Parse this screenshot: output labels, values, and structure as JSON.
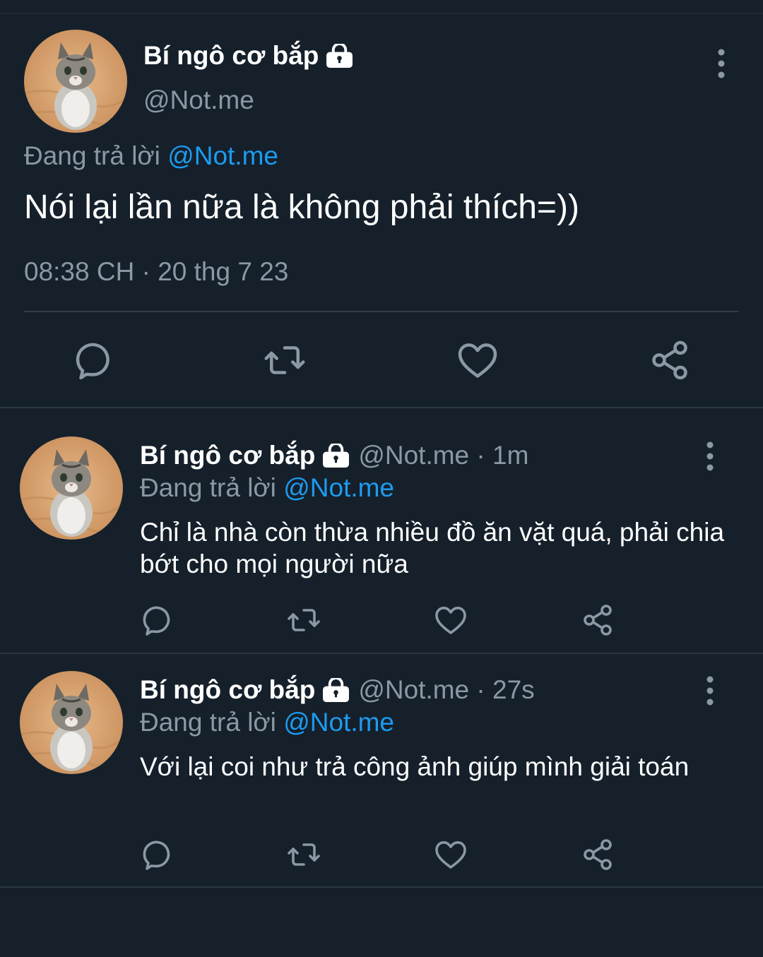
{
  "main_tweet": {
    "author_name": "Bí ngô cơ bắp",
    "handle": "@Not.me",
    "replying_prefix": "Đang trả lời",
    "replying_to": "@Not.me",
    "text": "Nói lại lần nữa là không phải thích=))",
    "timestamp": "08:38 CH · 20 thg 7 23"
  },
  "replies": [
    {
      "author_name": "Bí ngô cơ bắp",
      "handle_time": "@Not.me · 1m",
      "replying_prefix": "Đang trả lời",
      "replying_to": "@Not.me",
      "text": "Chỉ là nhà còn thừa nhiều đồ ăn vặt quá, phải chia bớt cho mọi người nữa"
    },
    {
      "author_name": "Bí ngô cơ bắp",
      "handle_time": "@Not.me · 27s",
      "replying_prefix": "Đang trả lời",
      "replying_to": "@Not.me",
      "text": "Với lại coi như trả công ảnh giúp mình giải toán"
    }
  ],
  "icons": {
    "reply": "speech-bubble-icon",
    "retweet": "retweet-icon",
    "like": "heart-icon",
    "share": "share-icon",
    "more": "vertical-dots-icon",
    "protected": "lock-icon"
  },
  "colors": {
    "background": "#15202b",
    "primary_text": "#ffffff",
    "secondary_text": "#8b98a5",
    "mention": "#1d9bf0",
    "divider": "#2f3b47"
  }
}
